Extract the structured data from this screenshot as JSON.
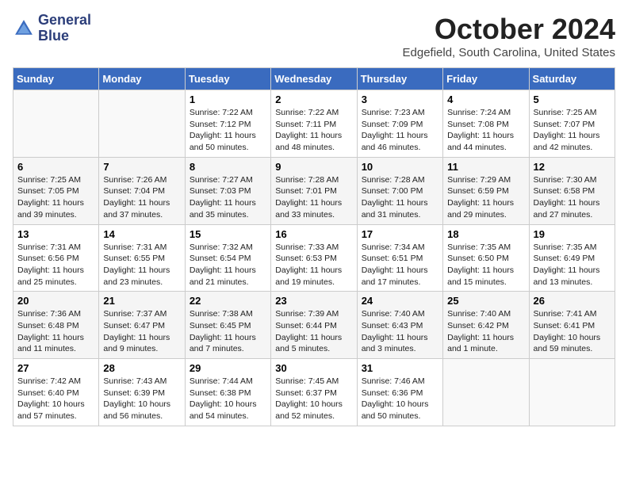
{
  "logo": {
    "line1": "General",
    "line2": "Blue"
  },
  "title": "October 2024",
  "location": "Edgefield, South Carolina, United States",
  "days_of_week": [
    "Sunday",
    "Monday",
    "Tuesday",
    "Wednesday",
    "Thursday",
    "Friday",
    "Saturday"
  ],
  "weeks": [
    [
      {
        "day": "",
        "info": ""
      },
      {
        "day": "",
        "info": ""
      },
      {
        "day": "1",
        "info": "Sunrise: 7:22 AM\nSunset: 7:12 PM\nDaylight: 11 hours and 50 minutes."
      },
      {
        "day": "2",
        "info": "Sunrise: 7:22 AM\nSunset: 7:11 PM\nDaylight: 11 hours and 48 minutes."
      },
      {
        "day": "3",
        "info": "Sunrise: 7:23 AM\nSunset: 7:09 PM\nDaylight: 11 hours and 46 minutes."
      },
      {
        "day": "4",
        "info": "Sunrise: 7:24 AM\nSunset: 7:08 PM\nDaylight: 11 hours and 44 minutes."
      },
      {
        "day": "5",
        "info": "Sunrise: 7:25 AM\nSunset: 7:07 PM\nDaylight: 11 hours and 42 minutes."
      }
    ],
    [
      {
        "day": "6",
        "info": "Sunrise: 7:25 AM\nSunset: 7:05 PM\nDaylight: 11 hours and 39 minutes."
      },
      {
        "day": "7",
        "info": "Sunrise: 7:26 AM\nSunset: 7:04 PM\nDaylight: 11 hours and 37 minutes."
      },
      {
        "day": "8",
        "info": "Sunrise: 7:27 AM\nSunset: 7:03 PM\nDaylight: 11 hours and 35 minutes."
      },
      {
        "day": "9",
        "info": "Sunrise: 7:28 AM\nSunset: 7:01 PM\nDaylight: 11 hours and 33 minutes."
      },
      {
        "day": "10",
        "info": "Sunrise: 7:28 AM\nSunset: 7:00 PM\nDaylight: 11 hours and 31 minutes."
      },
      {
        "day": "11",
        "info": "Sunrise: 7:29 AM\nSunset: 6:59 PM\nDaylight: 11 hours and 29 minutes."
      },
      {
        "day": "12",
        "info": "Sunrise: 7:30 AM\nSunset: 6:58 PM\nDaylight: 11 hours and 27 minutes."
      }
    ],
    [
      {
        "day": "13",
        "info": "Sunrise: 7:31 AM\nSunset: 6:56 PM\nDaylight: 11 hours and 25 minutes."
      },
      {
        "day": "14",
        "info": "Sunrise: 7:31 AM\nSunset: 6:55 PM\nDaylight: 11 hours and 23 minutes."
      },
      {
        "day": "15",
        "info": "Sunrise: 7:32 AM\nSunset: 6:54 PM\nDaylight: 11 hours and 21 minutes."
      },
      {
        "day": "16",
        "info": "Sunrise: 7:33 AM\nSunset: 6:53 PM\nDaylight: 11 hours and 19 minutes."
      },
      {
        "day": "17",
        "info": "Sunrise: 7:34 AM\nSunset: 6:51 PM\nDaylight: 11 hours and 17 minutes."
      },
      {
        "day": "18",
        "info": "Sunrise: 7:35 AM\nSunset: 6:50 PM\nDaylight: 11 hours and 15 minutes."
      },
      {
        "day": "19",
        "info": "Sunrise: 7:35 AM\nSunset: 6:49 PM\nDaylight: 11 hours and 13 minutes."
      }
    ],
    [
      {
        "day": "20",
        "info": "Sunrise: 7:36 AM\nSunset: 6:48 PM\nDaylight: 11 hours and 11 minutes."
      },
      {
        "day": "21",
        "info": "Sunrise: 7:37 AM\nSunset: 6:47 PM\nDaylight: 11 hours and 9 minutes."
      },
      {
        "day": "22",
        "info": "Sunrise: 7:38 AM\nSunset: 6:45 PM\nDaylight: 11 hours and 7 minutes."
      },
      {
        "day": "23",
        "info": "Sunrise: 7:39 AM\nSunset: 6:44 PM\nDaylight: 11 hours and 5 minutes."
      },
      {
        "day": "24",
        "info": "Sunrise: 7:40 AM\nSunset: 6:43 PM\nDaylight: 11 hours and 3 minutes."
      },
      {
        "day": "25",
        "info": "Sunrise: 7:40 AM\nSunset: 6:42 PM\nDaylight: 11 hours and 1 minute."
      },
      {
        "day": "26",
        "info": "Sunrise: 7:41 AM\nSunset: 6:41 PM\nDaylight: 10 hours and 59 minutes."
      }
    ],
    [
      {
        "day": "27",
        "info": "Sunrise: 7:42 AM\nSunset: 6:40 PM\nDaylight: 10 hours and 57 minutes."
      },
      {
        "day": "28",
        "info": "Sunrise: 7:43 AM\nSunset: 6:39 PM\nDaylight: 10 hours and 56 minutes."
      },
      {
        "day": "29",
        "info": "Sunrise: 7:44 AM\nSunset: 6:38 PM\nDaylight: 10 hours and 54 minutes."
      },
      {
        "day": "30",
        "info": "Sunrise: 7:45 AM\nSunset: 6:37 PM\nDaylight: 10 hours and 52 minutes."
      },
      {
        "day": "31",
        "info": "Sunrise: 7:46 AM\nSunset: 6:36 PM\nDaylight: 10 hours and 50 minutes."
      },
      {
        "day": "",
        "info": ""
      },
      {
        "day": "",
        "info": ""
      }
    ]
  ]
}
